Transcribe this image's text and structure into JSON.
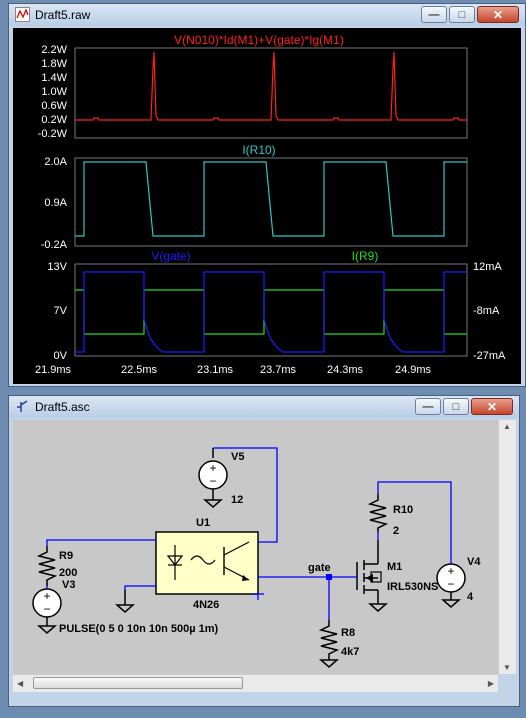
{
  "waveform_window": {
    "title": "Draft5.raw",
    "icon": "waveform-icon",
    "controls": {
      "minimize": "—",
      "maximize": "□",
      "close": "✕"
    }
  },
  "plot_panes": [
    {
      "trace_title": "V(N010)*Id(M1)+V(gate)*Ig(M1)",
      "trace_color": "#ff2020",
      "y_ticks": [
        "2.2W",
        "1.8W",
        "1.4W",
        "1.0W",
        "0.6W",
        "0.2W",
        "-0.2W"
      ]
    },
    {
      "trace_title": "I(R10)",
      "trace_color": "#28c8c8",
      "y_ticks": [
        "2.0A",
        "0.9A",
        "-0.2A"
      ]
    },
    {
      "left_trace_title": "V(gate)",
      "left_trace_color": "#1c1cff",
      "right_trace_title": "I(R9)",
      "right_trace_color": "#20dd20",
      "y_ticks_left": [
        "13V",
        "7V",
        "0V"
      ],
      "y_ticks_right": [
        "12mA",
        "-8mA",
        "-27mA"
      ]
    }
  ],
  "x_ticks": [
    "21.9ms",
    "22.5ms",
    "23.1ms",
    "23.7ms",
    "24.3ms",
    "24.9ms"
  ],
  "schematic_window": {
    "title": "Draft5.asc",
    "icon": "schematic-icon",
    "controls": {
      "minimize": "—",
      "maximize": "□",
      "close": "✕"
    }
  },
  "schematic": {
    "v5_name": "V5",
    "v5_value": "12",
    "r10_name": "R10",
    "r10_value": "2",
    "u1_name": "U1",
    "u1_part": "4N26",
    "r9_name": "R9",
    "r9_value": "200",
    "v3_name": "V3",
    "v3_value": "PULSE(0 5 0 10n 10n 500µ 1m)",
    "gate_label": "gate",
    "m1_name": "M1",
    "m1_part": "IRL530NS",
    "v4_name": "V4",
    "v4_value": "4",
    "r8_name": "R8",
    "r8_value": "4k7"
  },
  "colors": {
    "wire": "#0000ff",
    "component": "#000000",
    "optocoupler_fill": "#ffffc8",
    "plot_bg": "#000000"
  }
}
